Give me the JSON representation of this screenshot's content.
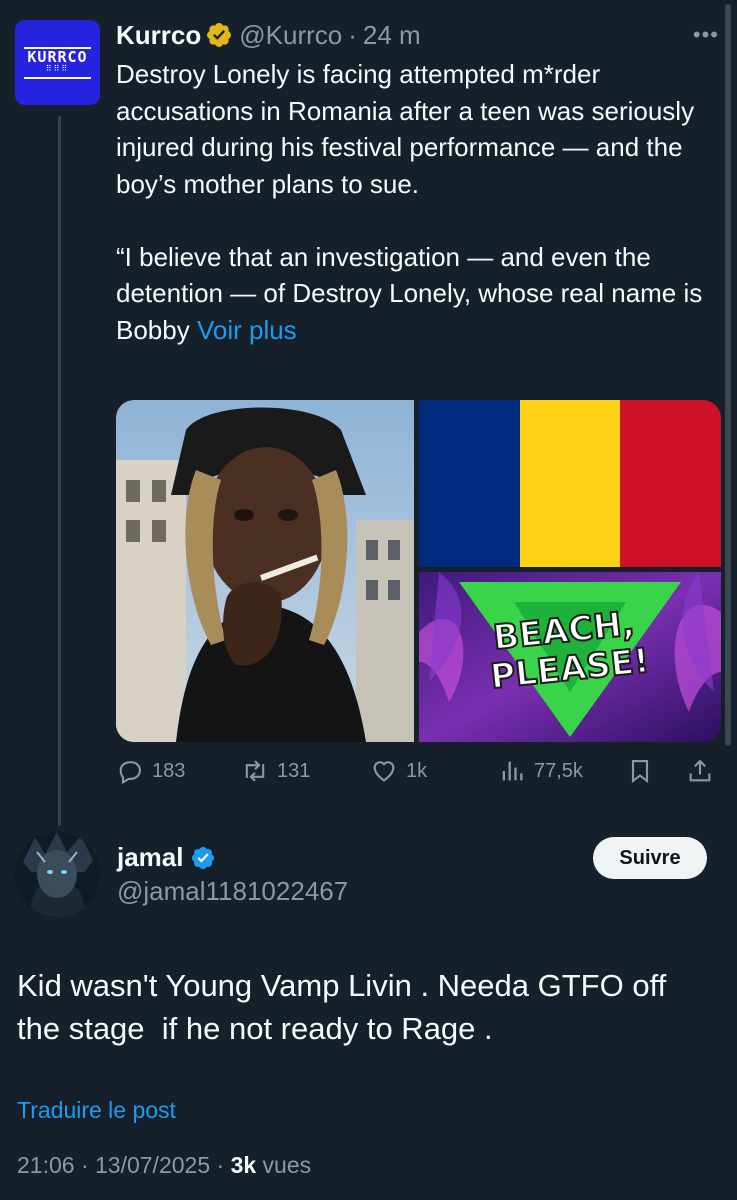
{
  "tweet1": {
    "avatar_logo": "KURRCO",
    "author_name": "Kurrco",
    "handle": "@Kurrco",
    "separator": "·",
    "time": "24 m",
    "more_icon": "ellipsis-icon",
    "text_p1": "Destroy Lonely is facing attempted m*rder accusations in Romania after a teen was seriously injured during his festival performance — and the boy’s mother plans to sue.",
    "text_p2": "“I believe that an investigation — and even the detention — of Destroy Lonely, whose real name is Bobby ",
    "see_more": "Voir plus",
    "poster_text": [
      "BEACH,",
      "PLEASE!"
    ],
    "flag_colors": [
      "#002B7F",
      "#FCD116",
      "#CE1126"
    ],
    "stats": {
      "replies": "183",
      "reposts": "131",
      "likes": "1k",
      "views": "77,5k"
    }
  },
  "tweet2": {
    "author_name": "jamal",
    "handle": "@jamal1181022467",
    "follow_label": "Suivre",
    "text_line1": "Kid wasn't Young Vamp Livin . Needa GTFO off",
    "text_line2": "the stage  if he not ready to Rage .",
    "translate_label": "Traduire le post",
    "timestamp": "21:06 · 13/07/2025 · ",
    "views_count": "3k",
    "views_label": " vues"
  },
  "colors": {
    "background": "#15202b",
    "accent": "#1d9bf0",
    "muted": "#8b98a5",
    "gold_badge": "#e2b719"
  }
}
